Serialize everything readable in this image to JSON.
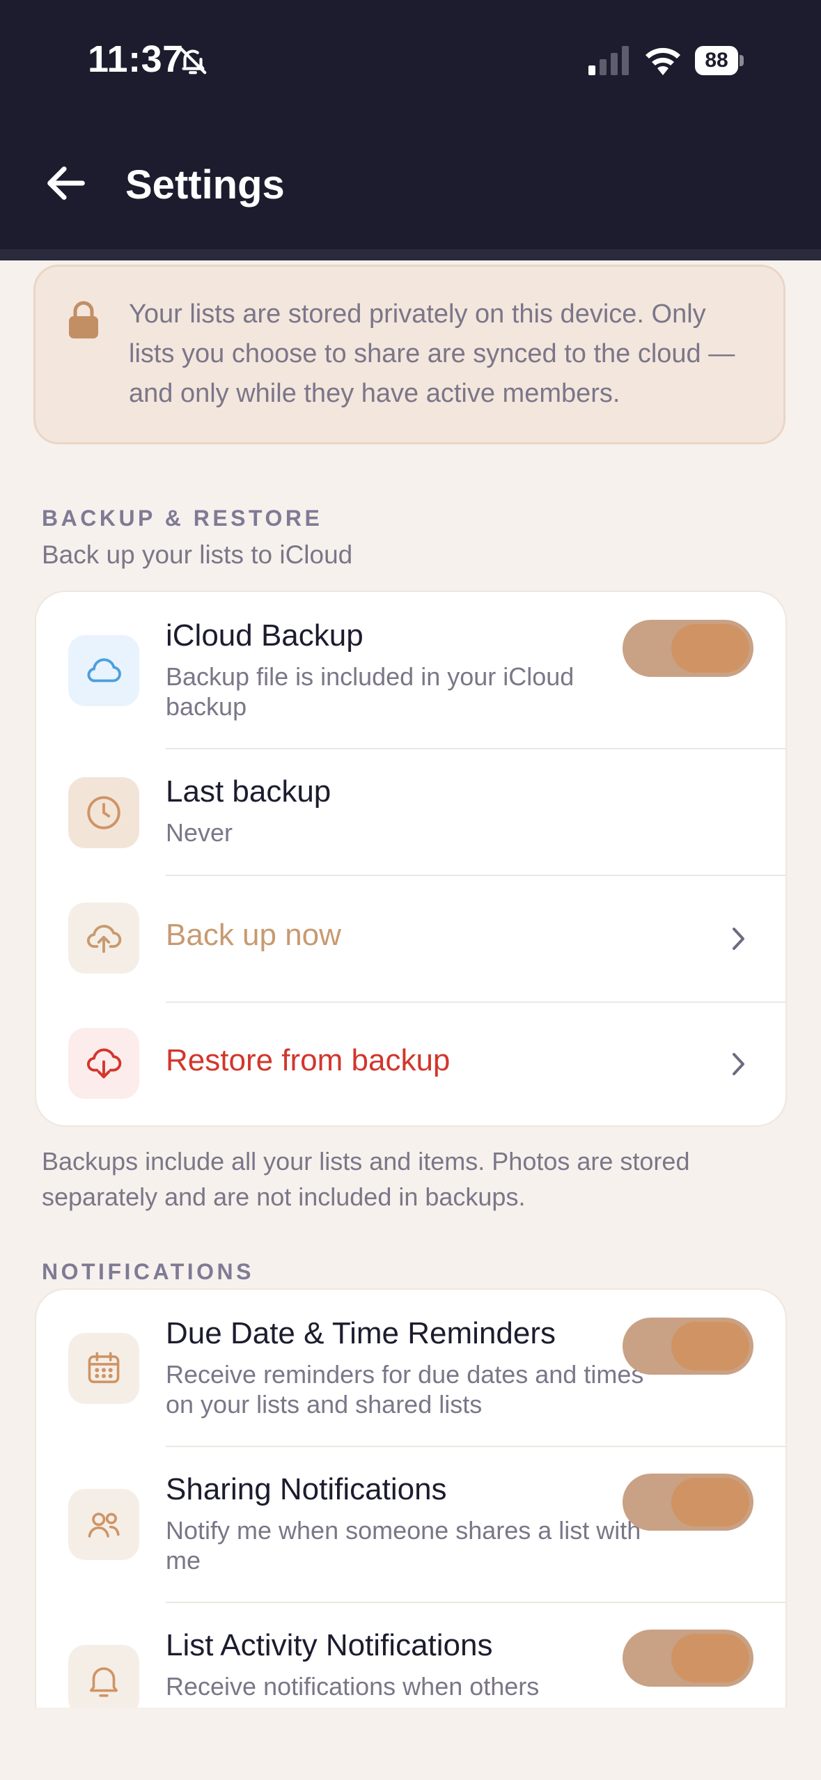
{
  "status_bar": {
    "time": "11:37",
    "battery": "88"
  },
  "header": {
    "title": "Settings"
  },
  "privacy_notice": "Your lists are stored privately on this device. Only lists you choose to share are synced to the cloud — and only while they have active members.",
  "backup_section": {
    "label": "BACKUP & RESTORE",
    "subtitle": "Back up your lists to iCloud",
    "icloud_backup": {
      "title": "iCloud Backup",
      "subtitle": "Backup file is included in your iCloud backup",
      "enabled": true
    },
    "last_backup": {
      "title": "Last backup",
      "value": "Never"
    },
    "back_up_now": {
      "label": "Back up now"
    },
    "restore": {
      "label": "Restore from backup"
    },
    "footnote": "Backups include all your lists and items. Photos are stored separately and are not included in backups."
  },
  "notifications_section": {
    "label": "NOTIFICATIONS",
    "items": [
      {
        "title": "Due Date & Time Reminders",
        "subtitle": "Receive reminders for due dates and times on your lists and shared lists",
        "enabled": true
      },
      {
        "title": "Sharing Notifications",
        "subtitle": "Notify me when someone shares a list with me",
        "enabled": true
      },
      {
        "title": "List Activity Notifications",
        "subtitle": "Receive notifications when others",
        "enabled": true
      }
    ]
  },
  "colors": {
    "header_bg": "#1c1c2e",
    "page_bg": "#f6f1ec",
    "accent": "#d09464",
    "back_up_now_text": "#c89a70",
    "restore_text": "#d2362c"
  }
}
